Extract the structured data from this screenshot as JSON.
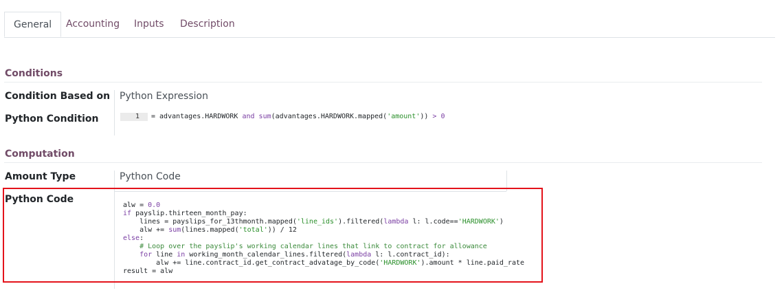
{
  "tabs": [
    {
      "label": "General",
      "active": true
    },
    {
      "label": "Accounting",
      "active": false
    },
    {
      "label": "Inputs",
      "active": false
    },
    {
      "label": "Description",
      "active": false
    }
  ],
  "conditions": {
    "title": "Conditions",
    "based_on_label": "Condition Based on",
    "based_on_value": "Python Expression",
    "python_condition_label": "Python Condition",
    "line_number": "1",
    "code": {
      "t1": "= advantages.HARDWORK ",
      "k1": "and",
      "t2": " ",
      "k2": "sum",
      "t3": "(advantages.HARDWORK.mapped(",
      "s1": "'amount'",
      "t4": ")) ",
      "n1": "> 0"
    }
  },
  "computation": {
    "title": "Computation",
    "amount_type_label": "Amount Type",
    "amount_type_value": "Python Code",
    "python_code_label": "Python Code",
    "code": {
      "l1a": "alw = ",
      "l1n": "0.0",
      "l2k": "if",
      "l2a": " payslip.thirteen_month_pay:",
      "l3a": "    lines = payslips_for_13thmonth.mapped(",
      "l3s1": "'line_ids'",
      "l3b": ").filtered(",
      "l3k": "lambda",
      "l3c": " l: l.code==",
      "l3s2": "'HARDWORK'",
      "l3d": ")",
      "l4a": "    alw += ",
      "l4k": "sum",
      "l4b": "(lines.mapped(",
      "l4s": "'total'",
      "l4c": ")) / 12",
      "l5k": "else",
      "l5a": ":",
      "l6c": "    # Loop over the payslip's working calendar lines that link to contract for allowance",
      "l7sp": "    ",
      "l7k1": "for",
      "l7a": " line ",
      "l7k2": "in",
      "l7b": " working_month_calendar_lines.filtered(",
      "l7k3": "lambda",
      "l7c": " l: l.contract_id):",
      "l8a": "        alw += line.contract_id.get_contract_advatage_by_code(",
      "l8s": "'HARDWORK'",
      "l8b": ").amount * line.paid_rate",
      "l9a": "result = alw"
    }
  },
  "colors": {
    "accent": "#714b67",
    "highlight": "#e3121a"
  }
}
